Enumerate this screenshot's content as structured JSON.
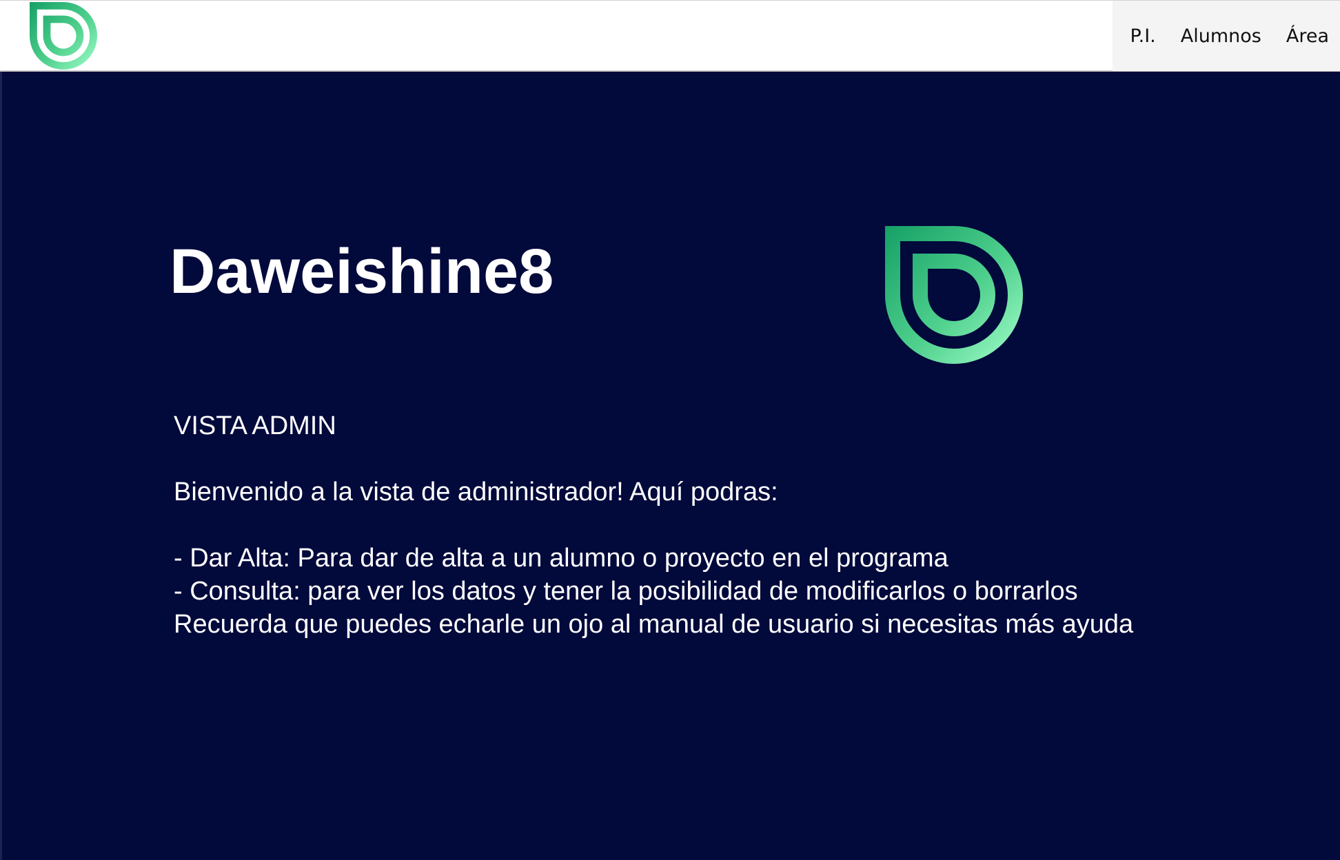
{
  "header": {
    "nav": [
      {
        "label": "P.I."
      },
      {
        "label": "Alumnos"
      },
      {
        "label": "Área"
      }
    ]
  },
  "hero": {
    "title": "Daweishine8"
  },
  "content": {
    "view_label": "VISTA ADMIN",
    "welcome": "Bienvenido a la vista de administrador! Aquí podras:",
    "items": [
      "- Dar Alta: Para dar de alta a un alumno o proyecto en el programa",
      "- Consulta: para ver los datos y tener la posibilidad de modificarlos o borrarlos"
    ],
    "reminder": "Recuerda que puedes echarle un ojo al manual de usuario si necesitas más ayuda"
  },
  "colors": {
    "background": "#02093b",
    "header_background": "#ffffff",
    "logo_gradient_start": "#1aa66a",
    "logo_gradient_end": "#9cfbc6"
  },
  "icons": {
    "header_logo": "brand-logo-icon",
    "hero_logo": "brand-logo-icon"
  }
}
